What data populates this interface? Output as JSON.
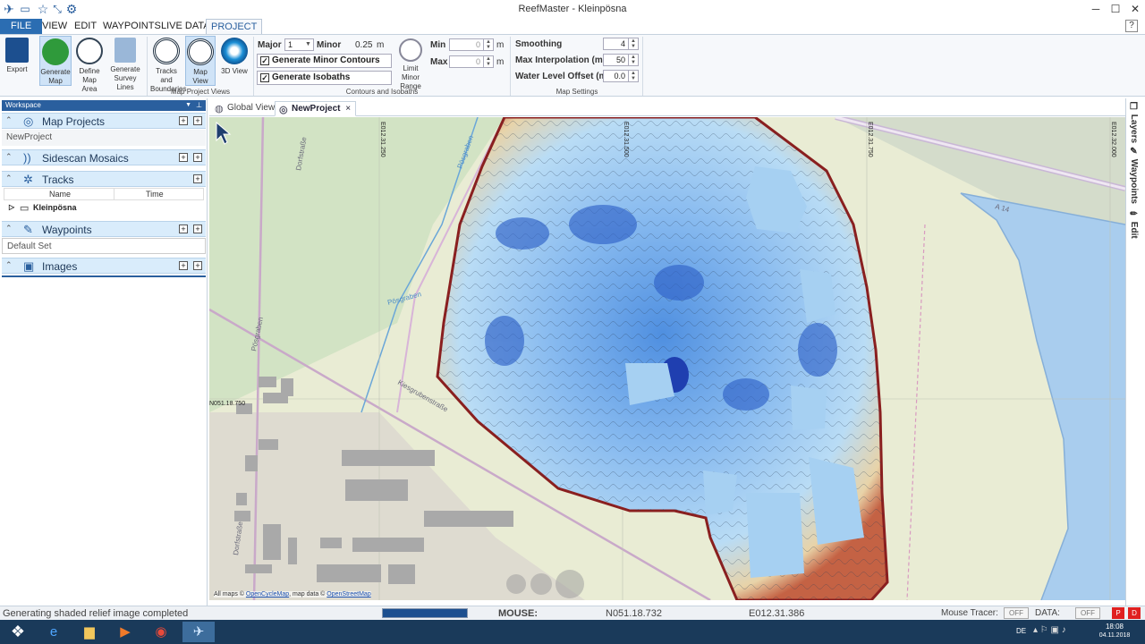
{
  "window": {
    "title": "ReefMaster - Kleinpösna"
  },
  "menu": [
    {
      "label": "FILE"
    },
    {
      "label": "VIEW"
    },
    {
      "label": "EDIT"
    },
    {
      "label": "WAYPOINTS"
    },
    {
      "label": "LIVE DATA"
    },
    {
      "label": "PROJECT"
    }
  ],
  "ribbon": {
    "buttons": {
      "export": "Export",
      "generate_map": "Generate Map",
      "define_area": "Define Map Area",
      "survey_lines": "Generate Survey Lines",
      "tracks_boundaries": "Tracks and Boundaries",
      "map_view": "Map View",
      "view_3d": "3D View",
      "limit_minor": "Limit Minor Range"
    },
    "groups": {
      "views": "Map Project Views",
      "contours": "Contours and Isobaths",
      "settings": "Map Settings"
    },
    "major_label": "Major",
    "major_value": "1",
    "minor_label": "Minor",
    "minor_value": "0.25",
    "minor_unit": "m",
    "gen_minor": "Generate Minor Contours",
    "gen_isobaths": "Generate Isobaths",
    "min_label": "Min",
    "max_label": "Max",
    "min_value": "0",
    "max_value": "0",
    "unit_m": "m",
    "smoothing_label": "Smoothing",
    "smoothing_value": "4",
    "max_interp_label": "Max Interpolation (m)",
    "max_interp_value": "50",
    "water_offset_label": "Water Level Offset (m)",
    "water_offset_value": "0.0"
  },
  "workspace": {
    "title": "Workspace",
    "sections": {
      "map_projects": "Map Projects",
      "project_item": "NewProject",
      "sidescan": "Sidescan Mosaics",
      "tracks": "Tracks",
      "col_name": "Name",
      "col_time": "Time",
      "track_item": "Kleinpösna",
      "waypoints": "Waypoints",
      "waypoint_set": "Default Set",
      "images": "Images"
    }
  },
  "tabs": [
    {
      "label": "Global View"
    },
    {
      "label": "NewProject"
    }
  ],
  "map": {
    "grid_labels": {
      "e1": "E012.31.250",
      "e2": "E012.31.500",
      "e3": "E012.31.750",
      "e4": "E012.32.000",
      "n1": "N051.18.750"
    },
    "street_labels": {
      "dorf1": "Dorfstraße",
      "dorf2": "Dorfstraße",
      "kies": "Kiesgrubenstraße",
      "pos1": "Pösgraben",
      "pos2": "Pösgraben",
      "pos3": "Pösgraben",
      "road": "A 14"
    },
    "attribution_prefix": "All maps ©",
    "attribution_link1": "OpenCycleMap",
    "attribution_mid": ", map data ©",
    "attribution_link2": "OpenStreetMap"
  },
  "right_tabs": {
    "layers": "Layers",
    "waypoints": "Waypoints",
    "edit": "Edit"
  },
  "status": {
    "message": "Generating shaded relief image completed",
    "progress": 1.0,
    "mouse_label": "MOUSE:",
    "lat": "N051.18.732",
    "lon": "E012.31.386",
    "mouse_tracer_label": "Mouse Tracer:",
    "data_label": "DATA:",
    "off1": "OFF",
    "off2": "OFF"
  },
  "tray": {
    "lang": "DE",
    "time": "18:08",
    "date": "04.11.2018"
  },
  "colors": {
    "accent": "#2b6db2",
    "water": "#a9cdee",
    "deep": "#1f4fb8",
    "shore": "#8a1f1f"
  }
}
